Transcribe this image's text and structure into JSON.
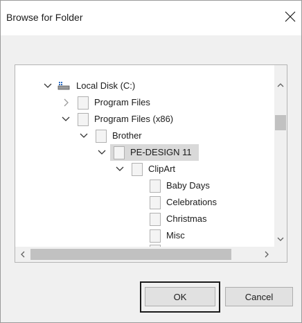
{
  "dialog": {
    "title": "Browse for Folder",
    "close_icon": "close-icon"
  },
  "tree": {
    "items": [
      {
        "label": "Local Disk (C:)",
        "icon": "drive-icon",
        "expanded": true
      },
      {
        "label": "Program Files",
        "icon": "folder-icon",
        "expanded": false
      },
      {
        "label": "Program Files (x86)",
        "icon": "folder-icon",
        "expanded": true
      },
      {
        "label": "Brother",
        "icon": "folder-icon",
        "expanded": true
      },
      {
        "label": "PE-DESIGN 11",
        "icon": "folder-icon",
        "expanded": true,
        "selected": true
      },
      {
        "label": "ClipArt",
        "icon": "folder-icon",
        "expanded": true
      },
      {
        "label": "Baby Days",
        "icon": "folder-icon"
      },
      {
        "label": "Celebrations",
        "icon": "folder-icon"
      },
      {
        "label": "Christmas",
        "icon": "folder-icon"
      },
      {
        "label": "Misc",
        "icon": "folder-icon"
      }
    ]
  },
  "buttons": {
    "ok_label": "OK",
    "cancel_label": "Cancel"
  },
  "colors": {
    "selection": "#d9d9d9",
    "highlight_frame": "#1a1a1a"
  }
}
